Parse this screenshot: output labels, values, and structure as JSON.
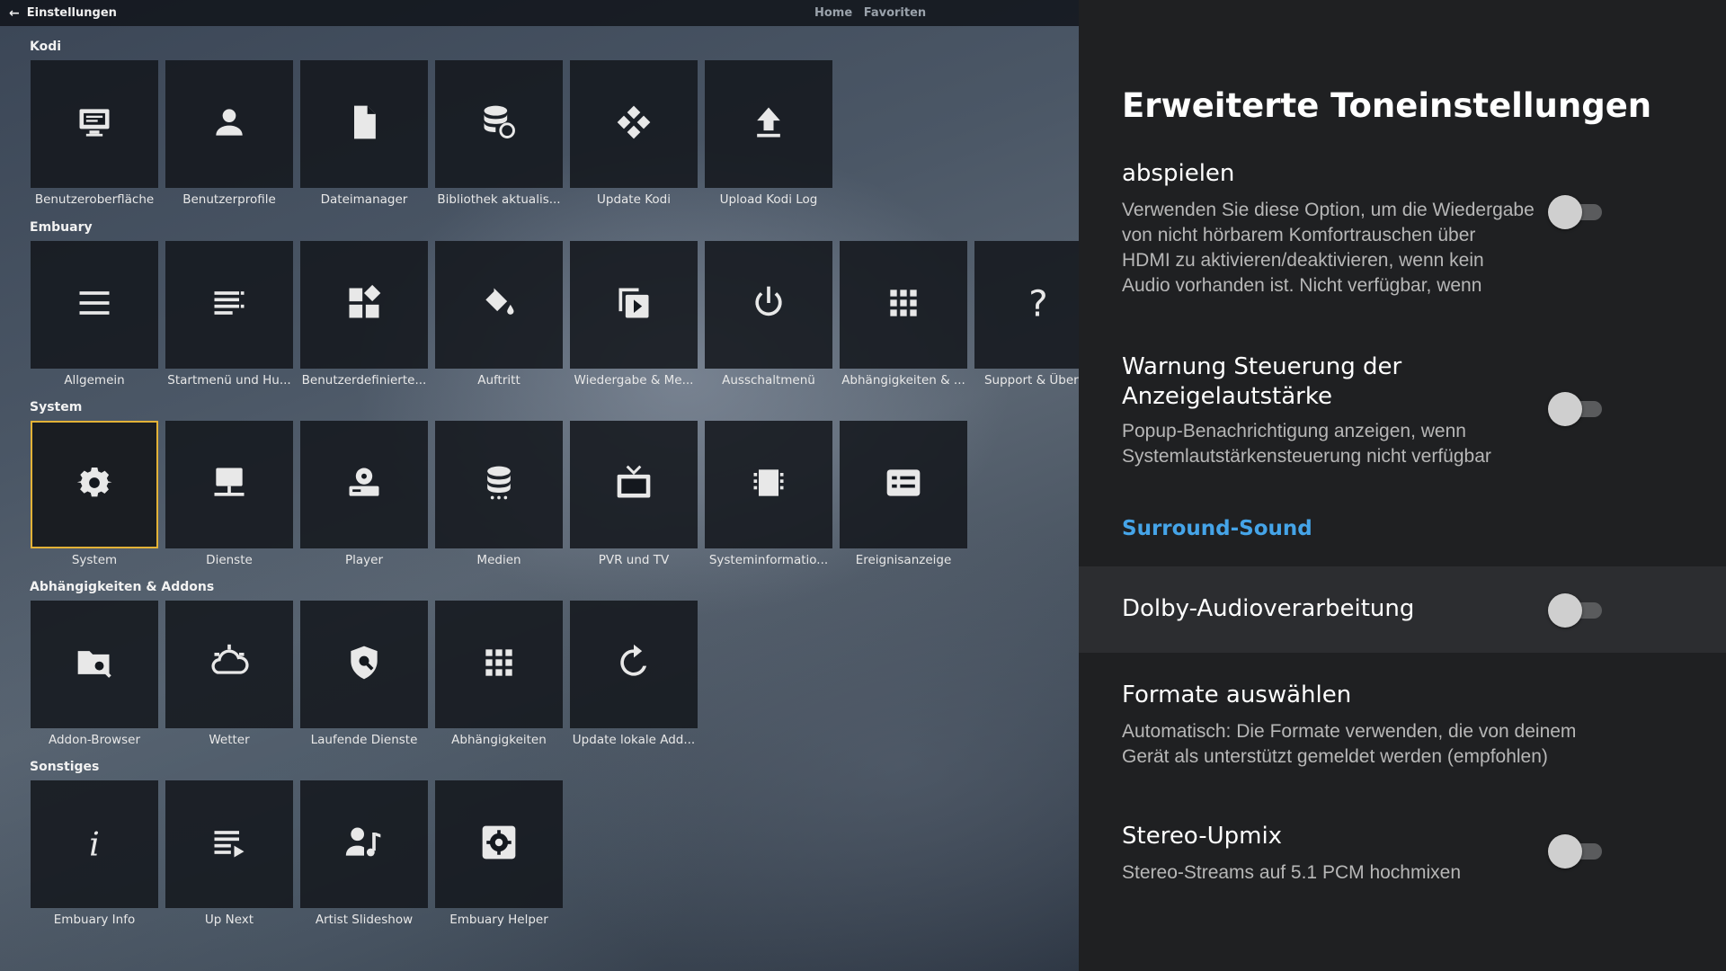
{
  "topbar": {
    "back_label": "Einstellungen",
    "nav": [
      "Home",
      "Favoriten"
    ]
  },
  "sections": [
    {
      "title": "Kodi",
      "tiles": [
        {
          "label": "Benutzeroberfläche",
          "icon": "monitor-icon"
        },
        {
          "label": "Benutzerprofile",
          "icon": "user-icon"
        },
        {
          "label": "Dateimanager",
          "icon": "file-icon"
        },
        {
          "label": "Bibliothek aktualis...",
          "icon": "database-sync-icon"
        },
        {
          "label": "Update Kodi",
          "icon": "kodi-logo-icon"
        },
        {
          "label": "Upload Kodi Log",
          "icon": "upload-icon"
        }
      ]
    },
    {
      "title": "Embuary",
      "tiles": [
        {
          "label": "Allgemein",
          "icon": "menu-lines-icon"
        },
        {
          "label": "Startmenü und Hu...",
          "icon": "list-icon"
        },
        {
          "label": "Benutzerdefinierte...",
          "icon": "widgets-icon"
        },
        {
          "label": "Auftritt",
          "icon": "paint-bucket-icon"
        },
        {
          "label": "Wiedergabe & Me...",
          "icon": "playlist-play-icon"
        },
        {
          "label": "Ausschaltmenü",
          "icon": "power-icon"
        },
        {
          "label": "Abhängigkeiten & ...",
          "icon": "apps-grid-icon"
        },
        {
          "label": "Support & Überse",
          "icon": "question-icon"
        }
      ]
    },
    {
      "title": "System",
      "tiles": [
        {
          "label": "System",
          "icon": "gear-icon"
        },
        {
          "label": "Dienste",
          "icon": "network-monitor-icon"
        },
        {
          "label": "Player",
          "icon": "player-icon"
        },
        {
          "label": "Medien",
          "icon": "media-database-icon"
        },
        {
          "label": "PVR und TV",
          "icon": "tv-icon"
        },
        {
          "label": "Systeminformatio...",
          "icon": "chip-icon"
        },
        {
          "label": "Ereignisanzeige",
          "icon": "event-list-icon"
        }
      ]
    },
    {
      "title": "Abhängigkeiten & Addons",
      "tiles": [
        {
          "label": "Addon-Browser",
          "icon": "folder-search-icon"
        },
        {
          "label": "Wetter",
          "icon": "weather-icon"
        },
        {
          "label": "Laufende Dienste",
          "icon": "shield-icon"
        },
        {
          "label": "Abhängigkeiten",
          "icon": "apps-grid-icon"
        },
        {
          "label": "Update lokale Add...",
          "icon": "refresh-icon"
        }
      ]
    },
    {
      "title": "Sonstiges",
      "tiles": [
        {
          "label": "Embuary Info",
          "icon": "info-icon"
        },
        {
          "label": "Up Next",
          "icon": "playlist-next-icon"
        },
        {
          "label": "Artist Slideshow",
          "icon": "artist-music-icon"
        },
        {
          "label": "Embuary Helper",
          "icon": "settings-box-icon"
        }
      ]
    }
  ],
  "focused_tile": "System",
  "focus_color": "#e3b237",
  "panel": {
    "title": "Erweiterte Toneinstellungen",
    "item1": {
      "title": "abspielen",
      "desc": [
        "Verwenden Sie diese Option, um die Wiedergabe",
        "von nicht hörbarem Komfortrauschen über",
        "HDMI zu aktivieren/deaktivieren, wenn kein",
        "Audio vorhanden ist. Nicht verfügbar, wenn"
      ]
    },
    "item2": {
      "title": [
        "Warnung Steuerung der",
        "Anzeigelautstärke"
      ],
      "desc": [
        "Popup-Benachrichtigung anzeigen, wenn",
        "Systemlautstärkensteuerung nicht verfügbar"
      ]
    },
    "section_header": "Surround-Sound",
    "section_color": "#45a4e8",
    "item3": {
      "title": "Dolby-Audioverarbeitung"
    },
    "item4": {
      "title": "Formate auswählen",
      "desc": [
        "Automatisch: Die Formate verwenden, die von deinem",
        "Gerät als unterstützt gemeldet werden (empfohlen)"
      ]
    },
    "item5": {
      "title": "Stereo-Upmix",
      "desc": [
        "Stereo-Streams auf 5.1 PCM hochmixen"
      ]
    }
  }
}
